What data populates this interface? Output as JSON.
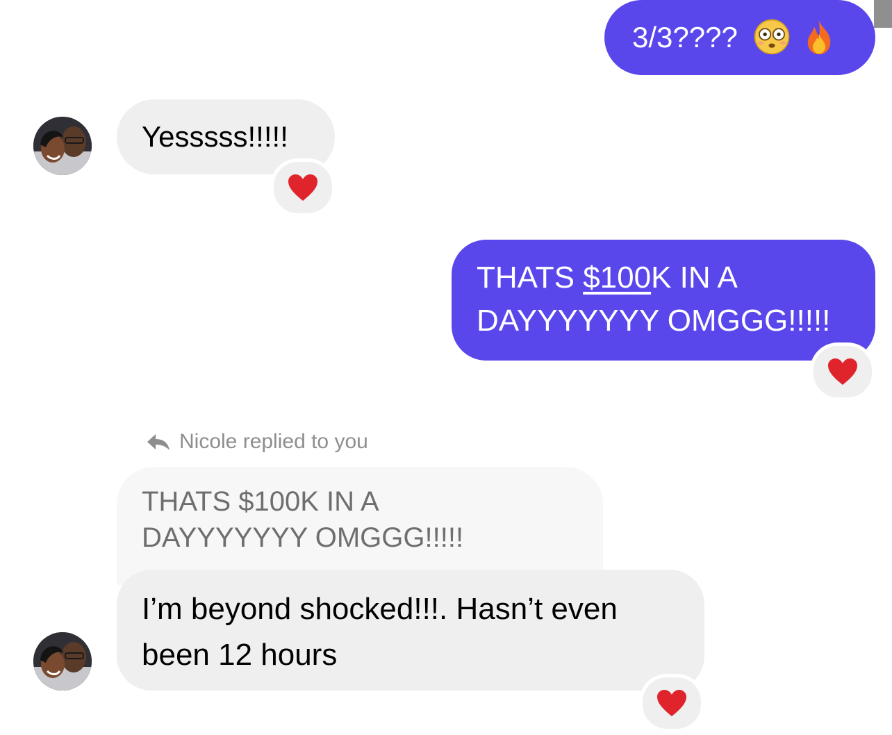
{
  "messages": {
    "m1": {
      "text": "3/3????",
      "emojis": [
        "flushed-face",
        "fire"
      ]
    },
    "m2": {
      "text": "Yesssss!!!!!",
      "reaction": "red-heart"
    },
    "m3": {
      "text_part1": "THATS ",
      "underlined": "$100",
      "text_part2": "K IN A",
      "line2": "DAYYYYYYY OMGGG!!!!!",
      "reaction": "red-heart"
    },
    "reply_label": "Nicole replied to you",
    "quoted": {
      "line1": "THATS $100K IN A",
      "line2": "DAYYYYYYY OMGGG!!!!!"
    },
    "m4": {
      "line1": "I’m beyond shocked!!!. Hasn’t even",
      "line2": "been 12 hours",
      "reaction": "red-heart"
    }
  },
  "colors": {
    "sent_bubble": "#5a47ec",
    "received_bubble": "#efefef",
    "quoted_bubble": "#f7f7f7",
    "meta_text": "#8e8e8e",
    "heart": "#e0242b"
  }
}
